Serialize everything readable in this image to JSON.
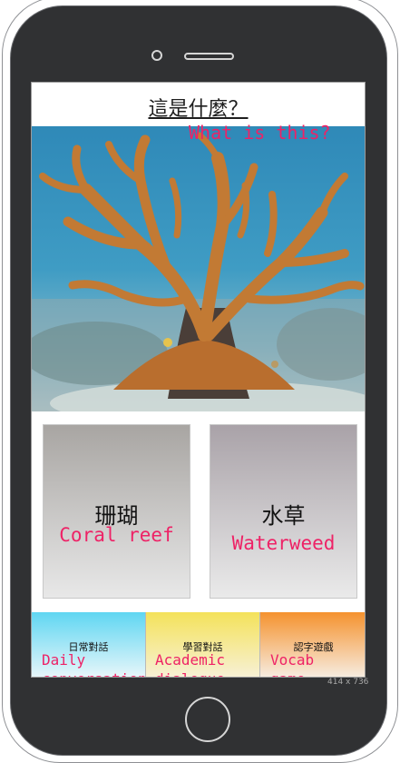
{
  "device": {
    "size_label": "414 x 736"
  },
  "question": {
    "title": "這是什麼？",
    "subtitle": "What is this?"
  },
  "photo": {
    "subject": "elkhorn coral underwater"
  },
  "choices": [
    {
      "zh": "珊瑚",
      "en": "Coral reef"
    },
    {
      "zh": "水草",
      "en": "Waterweed"
    }
  ],
  "tabs": [
    {
      "zh": "日常對話",
      "en": "Daily conversation",
      "color": "#5fd6f2"
    },
    {
      "zh": "學習對話",
      "en": "Academic dialogue",
      "color": "#f4e25a"
    },
    {
      "zh": "認字遊戲",
      "en": "Vocab game",
      "color": "#f5922e"
    }
  ]
}
